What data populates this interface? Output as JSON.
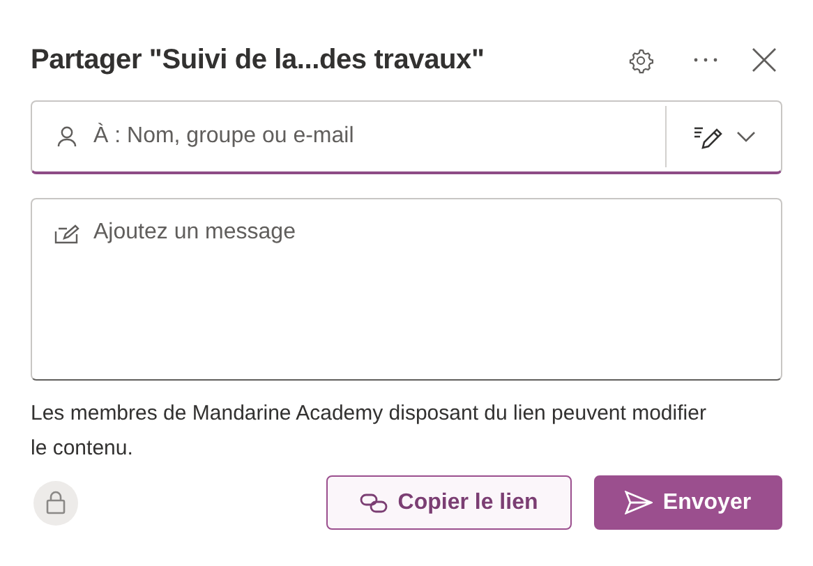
{
  "dialog": {
    "title": "Partager \"Suivi de la...des travaux\""
  },
  "recipients": {
    "placeholder": "À : Nom, groupe ou e-mail"
  },
  "message": {
    "placeholder": "Ajoutez un message"
  },
  "permission_note": "Les membres de Mandarine Academy disposant du lien peuvent modifier le contenu.",
  "buttons": [
    {
      "kind": "secondary",
      "label": "Copier le lien"
    },
    {
      "kind": "primary",
      "label": "Envoyer"
    }
  ]
}
